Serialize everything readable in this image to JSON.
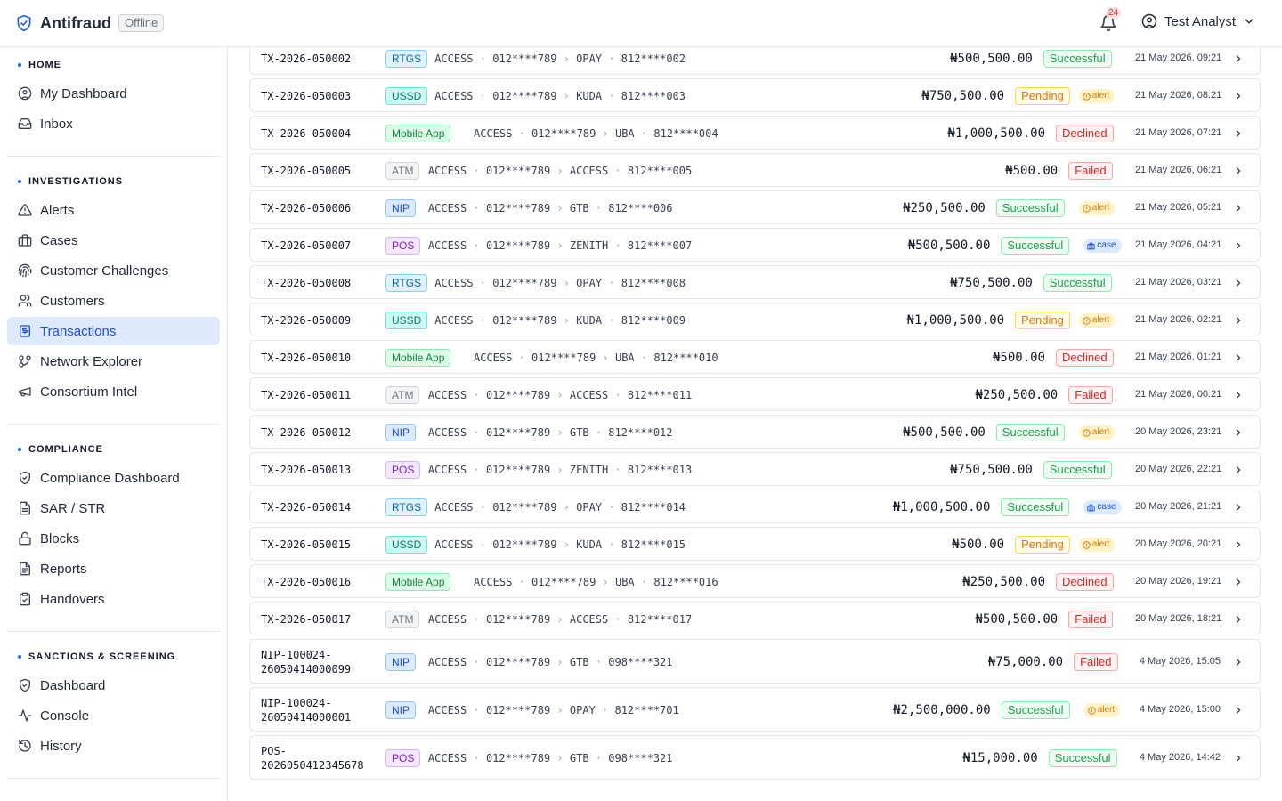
{
  "topbar": {
    "app_name": "Antifraud",
    "status_badge": "Offline",
    "notifications_count": "24",
    "user_name": "Test Analyst"
  },
  "sidebar": {
    "sections": [
      {
        "title": "HOME",
        "items": [
          {
            "label": "My Dashboard",
            "icon": "user-circle-icon",
            "active": false
          },
          {
            "label": "Inbox",
            "icon": "inbox-icon",
            "active": false
          }
        ]
      },
      {
        "title": "INVESTIGATIONS",
        "items": [
          {
            "label": "Alerts",
            "icon": "warning-triangle-icon",
            "active": false
          },
          {
            "label": "Cases",
            "icon": "briefcase-icon",
            "active": false
          },
          {
            "label": "Customer Challenges",
            "icon": "fingerprint-icon",
            "active": false
          },
          {
            "label": "Customers",
            "icon": "users-icon",
            "active": false
          },
          {
            "label": "Transactions",
            "icon": "receipt-icon",
            "active": true
          },
          {
            "label": "Network Explorer",
            "icon": "git-branch-icon",
            "active": false
          },
          {
            "label": "Consortium Intel",
            "icon": "megaphone-icon",
            "active": false
          }
        ]
      },
      {
        "title": "COMPLIANCE",
        "items": [
          {
            "label": "Compliance Dashboard",
            "icon": "shield-check-icon",
            "active": false
          },
          {
            "label": "SAR / STR",
            "icon": "document-icon",
            "active": false
          },
          {
            "label": "Blocks",
            "icon": "lock-icon",
            "active": false
          },
          {
            "label": "Reports",
            "icon": "document-text-icon",
            "active": false
          },
          {
            "label": "Handovers",
            "icon": "clipboard-check-icon",
            "active": false
          }
        ]
      },
      {
        "title": "SANCTIONS & SCREENING",
        "items": [
          {
            "label": "Dashboard",
            "icon": "shield-check-icon",
            "active": false
          },
          {
            "label": "Console",
            "icon": "activity-icon",
            "active": false
          },
          {
            "label": "History",
            "icon": "history-icon",
            "active": false
          }
        ]
      }
    ]
  },
  "colors": {
    "accent": "#2563eb",
    "active_bg": "#e0eaff",
    "successful": "#16a34a",
    "pending": "#d97706",
    "declined": "#dc2626",
    "failed": "#dc2626"
  },
  "transactions": [
    {
      "id": "TX-2026-050002",
      "channel": "RTGS",
      "from_bank": "ACCESS",
      "from_acct": "012****789",
      "to_bank": "OPAY",
      "to_acct": "812****002",
      "amount": "₦500,500.00",
      "status": "Successful",
      "flag": "",
      "time": "21 May 2026, 09:21"
    },
    {
      "id": "TX-2026-050003",
      "channel": "USSD",
      "from_bank": "ACCESS",
      "from_acct": "012****789",
      "to_bank": "KUDA",
      "to_acct": "812****003",
      "amount": "₦750,500.00",
      "status": "Pending",
      "flag": "alert",
      "time": "21 May 2026, 08:21"
    },
    {
      "id": "TX-2026-050004",
      "channel": "Mobile App",
      "from_bank": "ACCESS",
      "from_acct": "012****789",
      "to_bank": "UBA",
      "to_acct": "812****004",
      "amount": "₦1,000,500.00",
      "status": "Declined",
      "flag": "",
      "time": "21 May 2026, 07:21"
    },
    {
      "id": "TX-2026-050005",
      "channel": "ATM",
      "from_bank": "ACCESS",
      "from_acct": "012****789",
      "to_bank": "ACCESS",
      "to_acct": "812****005",
      "amount": "₦500.00",
      "status": "Failed",
      "flag": "",
      "time": "21 May 2026, 06:21"
    },
    {
      "id": "TX-2026-050006",
      "channel": "NIP",
      "from_bank": "ACCESS",
      "from_acct": "012****789",
      "to_bank": "GTB",
      "to_acct": "812****006",
      "amount": "₦250,500.00",
      "status": "Successful",
      "flag": "alert",
      "time": "21 May 2026, 05:21"
    },
    {
      "id": "TX-2026-050007",
      "channel": "POS",
      "from_bank": "ACCESS",
      "from_acct": "012****789",
      "to_bank": "ZENITH",
      "to_acct": "812****007",
      "amount": "₦500,500.00",
      "status": "Successful",
      "flag": "case",
      "time": "21 May 2026, 04:21"
    },
    {
      "id": "TX-2026-050008",
      "channel": "RTGS",
      "from_bank": "ACCESS",
      "from_acct": "012****789",
      "to_bank": "OPAY",
      "to_acct": "812****008",
      "amount": "₦750,500.00",
      "status": "Successful",
      "flag": "",
      "time": "21 May 2026, 03:21"
    },
    {
      "id": "TX-2026-050009",
      "channel": "USSD",
      "from_bank": "ACCESS",
      "from_acct": "012****789",
      "to_bank": "KUDA",
      "to_acct": "812****009",
      "amount": "₦1,000,500.00",
      "status": "Pending",
      "flag": "alert",
      "time": "21 May 2026, 02:21"
    },
    {
      "id": "TX-2026-050010",
      "channel": "Mobile App",
      "from_bank": "ACCESS",
      "from_acct": "012****789",
      "to_bank": "UBA",
      "to_acct": "812****010",
      "amount": "₦500.00",
      "status": "Declined",
      "flag": "",
      "time": "21 May 2026, 01:21"
    },
    {
      "id": "TX-2026-050011",
      "channel": "ATM",
      "from_bank": "ACCESS",
      "from_acct": "012****789",
      "to_bank": "ACCESS",
      "to_acct": "812****011",
      "amount": "₦250,500.00",
      "status": "Failed",
      "flag": "",
      "time": "21 May 2026, 00:21"
    },
    {
      "id": "TX-2026-050012",
      "channel": "NIP",
      "from_bank": "ACCESS",
      "from_acct": "012****789",
      "to_bank": "GTB",
      "to_acct": "812****012",
      "amount": "₦500,500.00",
      "status": "Successful",
      "flag": "alert",
      "time": "20 May 2026, 23:21"
    },
    {
      "id": "TX-2026-050013",
      "channel": "POS",
      "from_bank": "ACCESS",
      "from_acct": "012****789",
      "to_bank": "ZENITH",
      "to_acct": "812****013",
      "amount": "₦750,500.00",
      "status": "Successful",
      "flag": "",
      "time": "20 May 2026, 22:21"
    },
    {
      "id": "TX-2026-050014",
      "channel": "RTGS",
      "from_bank": "ACCESS",
      "from_acct": "012****789",
      "to_bank": "OPAY",
      "to_acct": "812****014",
      "amount": "₦1,000,500.00",
      "status": "Successful",
      "flag": "case",
      "time": "20 May 2026, 21:21"
    },
    {
      "id": "TX-2026-050015",
      "channel": "USSD",
      "from_bank": "ACCESS",
      "from_acct": "012****789",
      "to_bank": "KUDA",
      "to_acct": "812****015",
      "amount": "₦500.00",
      "status": "Pending",
      "flag": "alert",
      "time": "20 May 2026, 20:21"
    },
    {
      "id": "TX-2026-050016",
      "channel": "Mobile App",
      "from_bank": "ACCESS",
      "from_acct": "012****789",
      "to_bank": "UBA",
      "to_acct": "812****016",
      "amount": "₦250,500.00",
      "status": "Declined",
      "flag": "",
      "time": "20 May 2026, 19:21"
    },
    {
      "id": "TX-2026-050017",
      "channel": "ATM",
      "from_bank": "ACCESS",
      "from_acct": "012****789",
      "to_bank": "ACCESS",
      "to_acct": "812****017",
      "amount": "₦500,500.00",
      "status": "Failed",
      "flag": "",
      "time": "20 May 2026, 18:21"
    },
    {
      "id": "NIP-100024-26050414000099",
      "id_lines": [
        "NIP-100024-",
        "26050414000099"
      ],
      "channel": "NIP",
      "from_bank": "ACCESS",
      "from_acct": "012****789",
      "to_bank": "GTB",
      "to_acct": "098****321",
      "amount": "₦75,000.00",
      "status": "Failed",
      "flag": "",
      "time": "4 May 2026, 15:05"
    },
    {
      "id": "NIP-100024-26050414000001",
      "id_lines": [
        "NIP-100024-",
        "26050414000001"
      ],
      "channel": "NIP",
      "from_bank": "ACCESS",
      "from_acct": "012****789",
      "to_bank": "OPAY",
      "to_acct": "812****701",
      "amount": "₦2,500,000.00",
      "status": "Successful",
      "flag": "alert",
      "time": "4 May 2026, 15:00"
    },
    {
      "id": "POS-2026050412345678",
      "id_lines": [
        "POS-",
        "2026050412345678"
      ],
      "channel": "POS",
      "from_bank": "ACCESS",
      "from_acct": "012****789",
      "to_bank": "GTB",
      "to_acct": "098****321",
      "amount": "₦15,000.00",
      "status": "Successful",
      "flag": "",
      "time": "4 May 2026, 14:42"
    }
  ]
}
